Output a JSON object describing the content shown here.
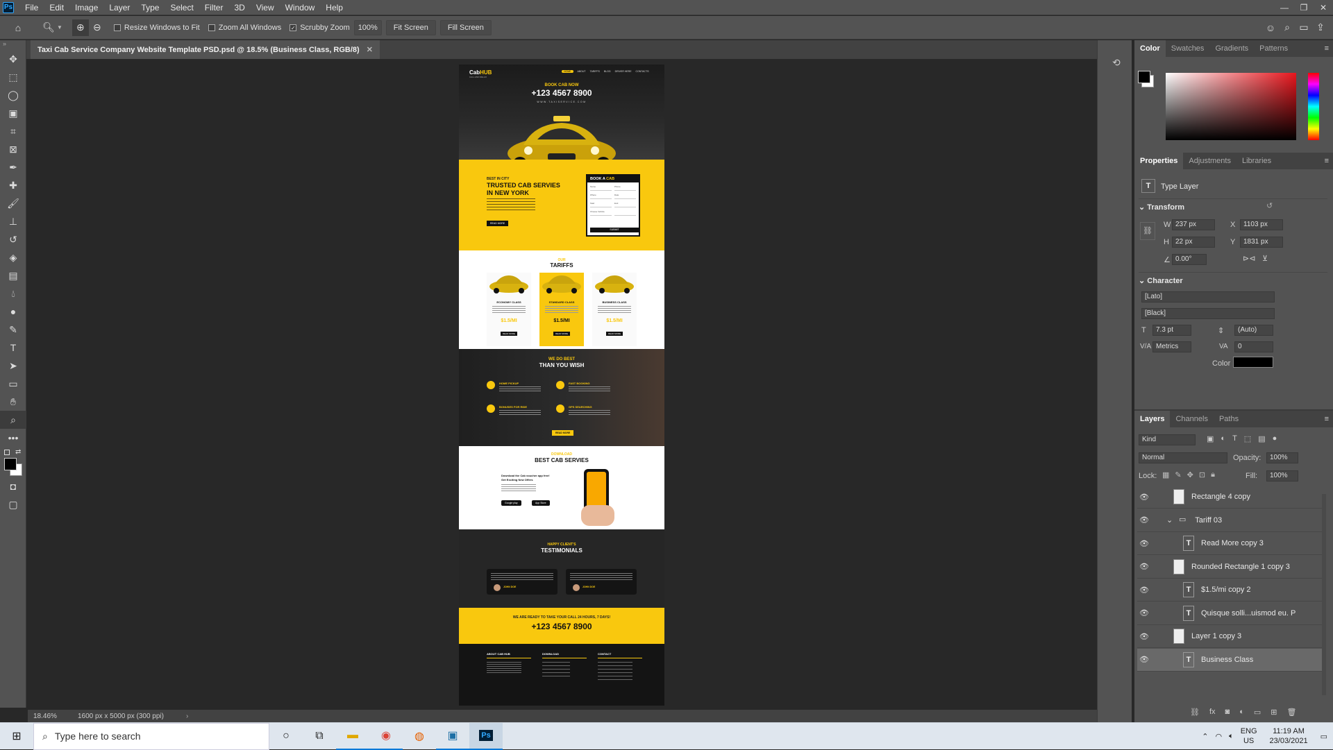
{
  "menubar": {
    "logo": "Ps",
    "items": [
      "File",
      "Edit",
      "Image",
      "Layer",
      "Type",
      "Select",
      "Filter",
      "3D",
      "View",
      "Window",
      "Help"
    ]
  },
  "options": {
    "resize_windows": "Resize Windows to Fit",
    "zoom_all": "Zoom All Windows",
    "scrubby": "Scrubby Zoom",
    "zoom_value": "100%",
    "fit_screen": "Fit Screen",
    "fill_screen": "Fill Screen"
  },
  "document": {
    "tab_title": "Taxi Cab Service Company Website Template PSD.psd @ 18.5% (Business Class, RGB/8)",
    "zoom": "18.46%",
    "size_info": "1600 px x 5000 px (300 ppi)"
  },
  "site": {
    "logo_a": "Cab",
    "logo_b": "HUB",
    "logo_sub": "CALL AND RELAX",
    "nav": [
      "HOME",
      "ABOUT",
      "TARIFFS",
      "BLOG",
      "DRIVER HERE",
      "CONTACTS"
    ],
    "hero_top": "BOOK CAB NOW",
    "hero_phone": "+123 4567 8900",
    "hero_url": "WWW.TAXISERVICE.COM",
    "best_in_city": "BEST IN CITY",
    "trusted_1": "TRUSTED CAB SERVIES",
    "trusted_2": "IN NEW YORK",
    "read_more": "READ MORE",
    "book_a": "BOOK A ",
    "book_cab": "CAB",
    "form_fields": [
      [
        "Name",
        "Phone"
      ],
      [
        "Where",
        "Date"
      ],
      [
        "Start",
        "End"
      ],
      [
        "Choose Vehicle",
        ""
      ]
    ],
    "submit": "SUBMIT",
    "tariffs_our": "OUR",
    "tariffs_title": "TARIFFS",
    "tariffs": [
      {
        "name": "ECONOMY CLASS",
        "price": "$1.5/MI"
      },
      {
        "name": "STANDARD CLASS",
        "price": "$1.5/MI"
      },
      {
        "name": "BUSINESS CLASS",
        "price": "$1.5/MI"
      }
    ],
    "tariff_btn": "READ MORE",
    "we_do_best": "WE DO BEST",
    "than_you_wish": "THAN YOU WISH",
    "features": [
      "HOME PICKUP",
      "FAST BOOKING",
      "BONUSES FOR RIDE",
      "GPS SEARCHING"
    ],
    "features_btn": "READ MORE",
    "download_small": "DOWNLOAD",
    "download_title": "BEST CAB SERVIES",
    "download_text_1": "Download the Cab voucher app free!",
    "download_text_2": "Get Exciting New Offers",
    "store_1": "Google play",
    "store_2": "App Store",
    "happy": "HAPPY CLIENT'S",
    "testimonials": "TESTIMONIALS",
    "testimonial_names": [
      "JOHN DOE",
      "JOHN DOE"
    ],
    "cta_text": "WE ARE READY TO TAKE YOUR CALL 24 HOURS, 7 DAYS!",
    "cta_phone": "+123 4567 8900",
    "footer_cols": [
      "ABOUT CAB HUB",
      "DOWNLOAD",
      "CONTACT"
    ]
  },
  "color_panel": {
    "tabs": [
      "Color",
      "Swatches",
      "Gradients",
      "Patterns"
    ]
  },
  "properties": {
    "tabs": [
      "Properties",
      "Adjustments",
      "Libraries"
    ],
    "layer_type": "Type Layer",
    "transform_label": "Transform",
    "w_label": "W",
    "w": "237 px",
    "h_label": "H",
    "h": "22 px",
    "x_label": "X",
    "x": "1103 px",
    "y_label": "Y",
    "y": "1831 px",
    "angle": "0.00°",
    "character_label": "Character",
    "font": "[Lato]",
    "style": "[Black]",
    "size": "7.3 pt",
    "leading": "(Auto)",
    "kerning": "Metrics",
    "tracking": "0",
    "color_label": "Color"
  },
  "layers_panel": {
    "tabs": [
      "Layers",
      "Channels",
      "Paths"
    ],
    "kind": "Kind",
    "blend": "Normal",
    "opacity_label": "Opacity:",
    "opacity": "100%",
    "lock_label": "Lock:",
    "fill_label": "Fill:",
    "fill": "100%",
    "layers": [
      {
        "name": "Rectangle 4 copy",
        "type": "shape",
        "indent": 0
      },
      {
        "name": "Tariff 03",
        "type": "group",
        "indent": 0
      },
      {
        "name": "Read More  copy 3",
        "type": "text",
        "indent": 1
      },
      {
        "name": "Rounded Rectangle 1 copy 3",
        "type": "shape",
        "indent": 0
      },
      {
        "name": "$1.5/mi copy 2",
        "type": "text",
        "indent": 1
      },
      {
        "name": "Quisque solli...uismod eu. P",
        "type": "text",
        "indent": 1
      },
      {
        "name": "Layer 1 copy 3",
        "type": "shape",
        "indent": 0
      },
      {
        "name": "Business Class",
        "type": "text",
        "indent": 1,
        "selected": true
      }
    ]
  },
  "taskbar": {
    "search_placeholder": "Type here to search",
    "lang_1": "ENG",
    "lang_2": "US",
    "time": "11:19 AM",
    "date": "23/03/2021"
  },
  "colors": {
    "accent_yellow": "#f9c80e",
    "ps_bg": "#535353",
    "canvas_bg": "#282828"
  }
}
